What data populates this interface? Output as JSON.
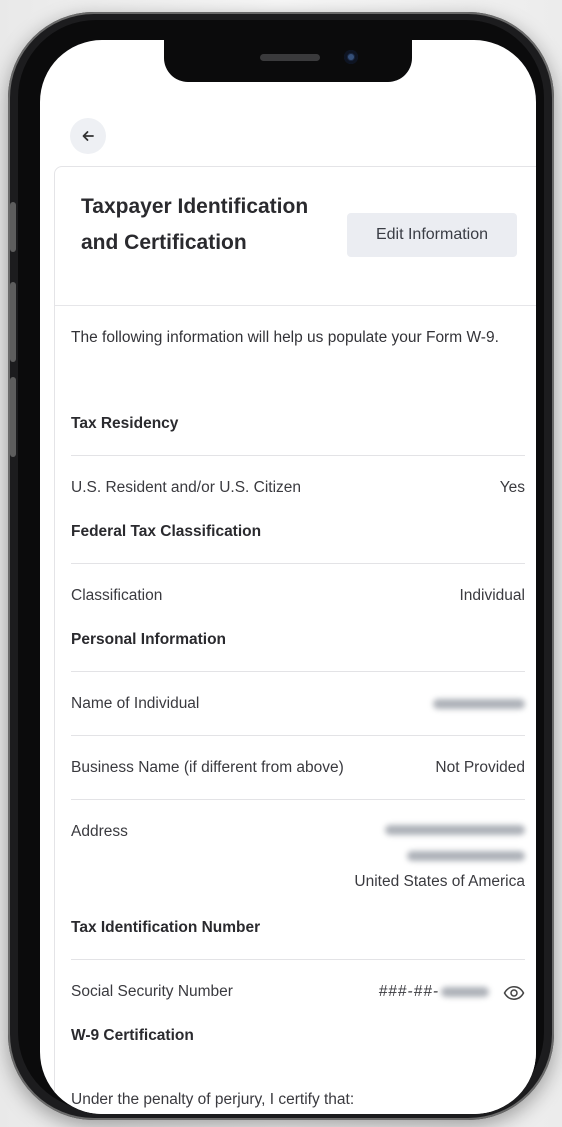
{
  "header": {
    "title": "Taxpayer Identification and Certification",
    "edit_button_label": "Edit Information"
  },
  "intro_text": "The following information will help us populate your Form W-9.",
  "tax_residency": {
    "heading": "Tax Residency",
    "label": "U.S. Resident and/or U.S. Citizen",
    "value": "Yes"
  },
  "federal_tax": {
    "heading": "Federal Tax Classification",
    "label": "Classification",
    "value": "Individual"
  },
  "personal_info": {
    "heading": "Personal Information",
    "name_label": "Name of Individual",
    "business_label": "Business Name (if different from above)",
    "business_value": "Not Provided",
    "address_label": "Address",
    "address_country": "United States of America"
  },
  "tin": {
    "heading": "Tax Identification Number",
    "ssn_label": "Social Security Number",
    "ssn_masked": "###-##-"
  },
  "certification": {
    "heading": "W-9 Certification",
    "text": "Under the penalty of perjury, I certify that:"
  },
  "icons": {
    "back": "arrow-left-icon",
    "reveal": "eye-icon"
  },
  "colors": {
    "button_bg": "#ebedf2",
    "text": "#2a2a2e",
    "divider": "#e3e3e6"
  }
}
